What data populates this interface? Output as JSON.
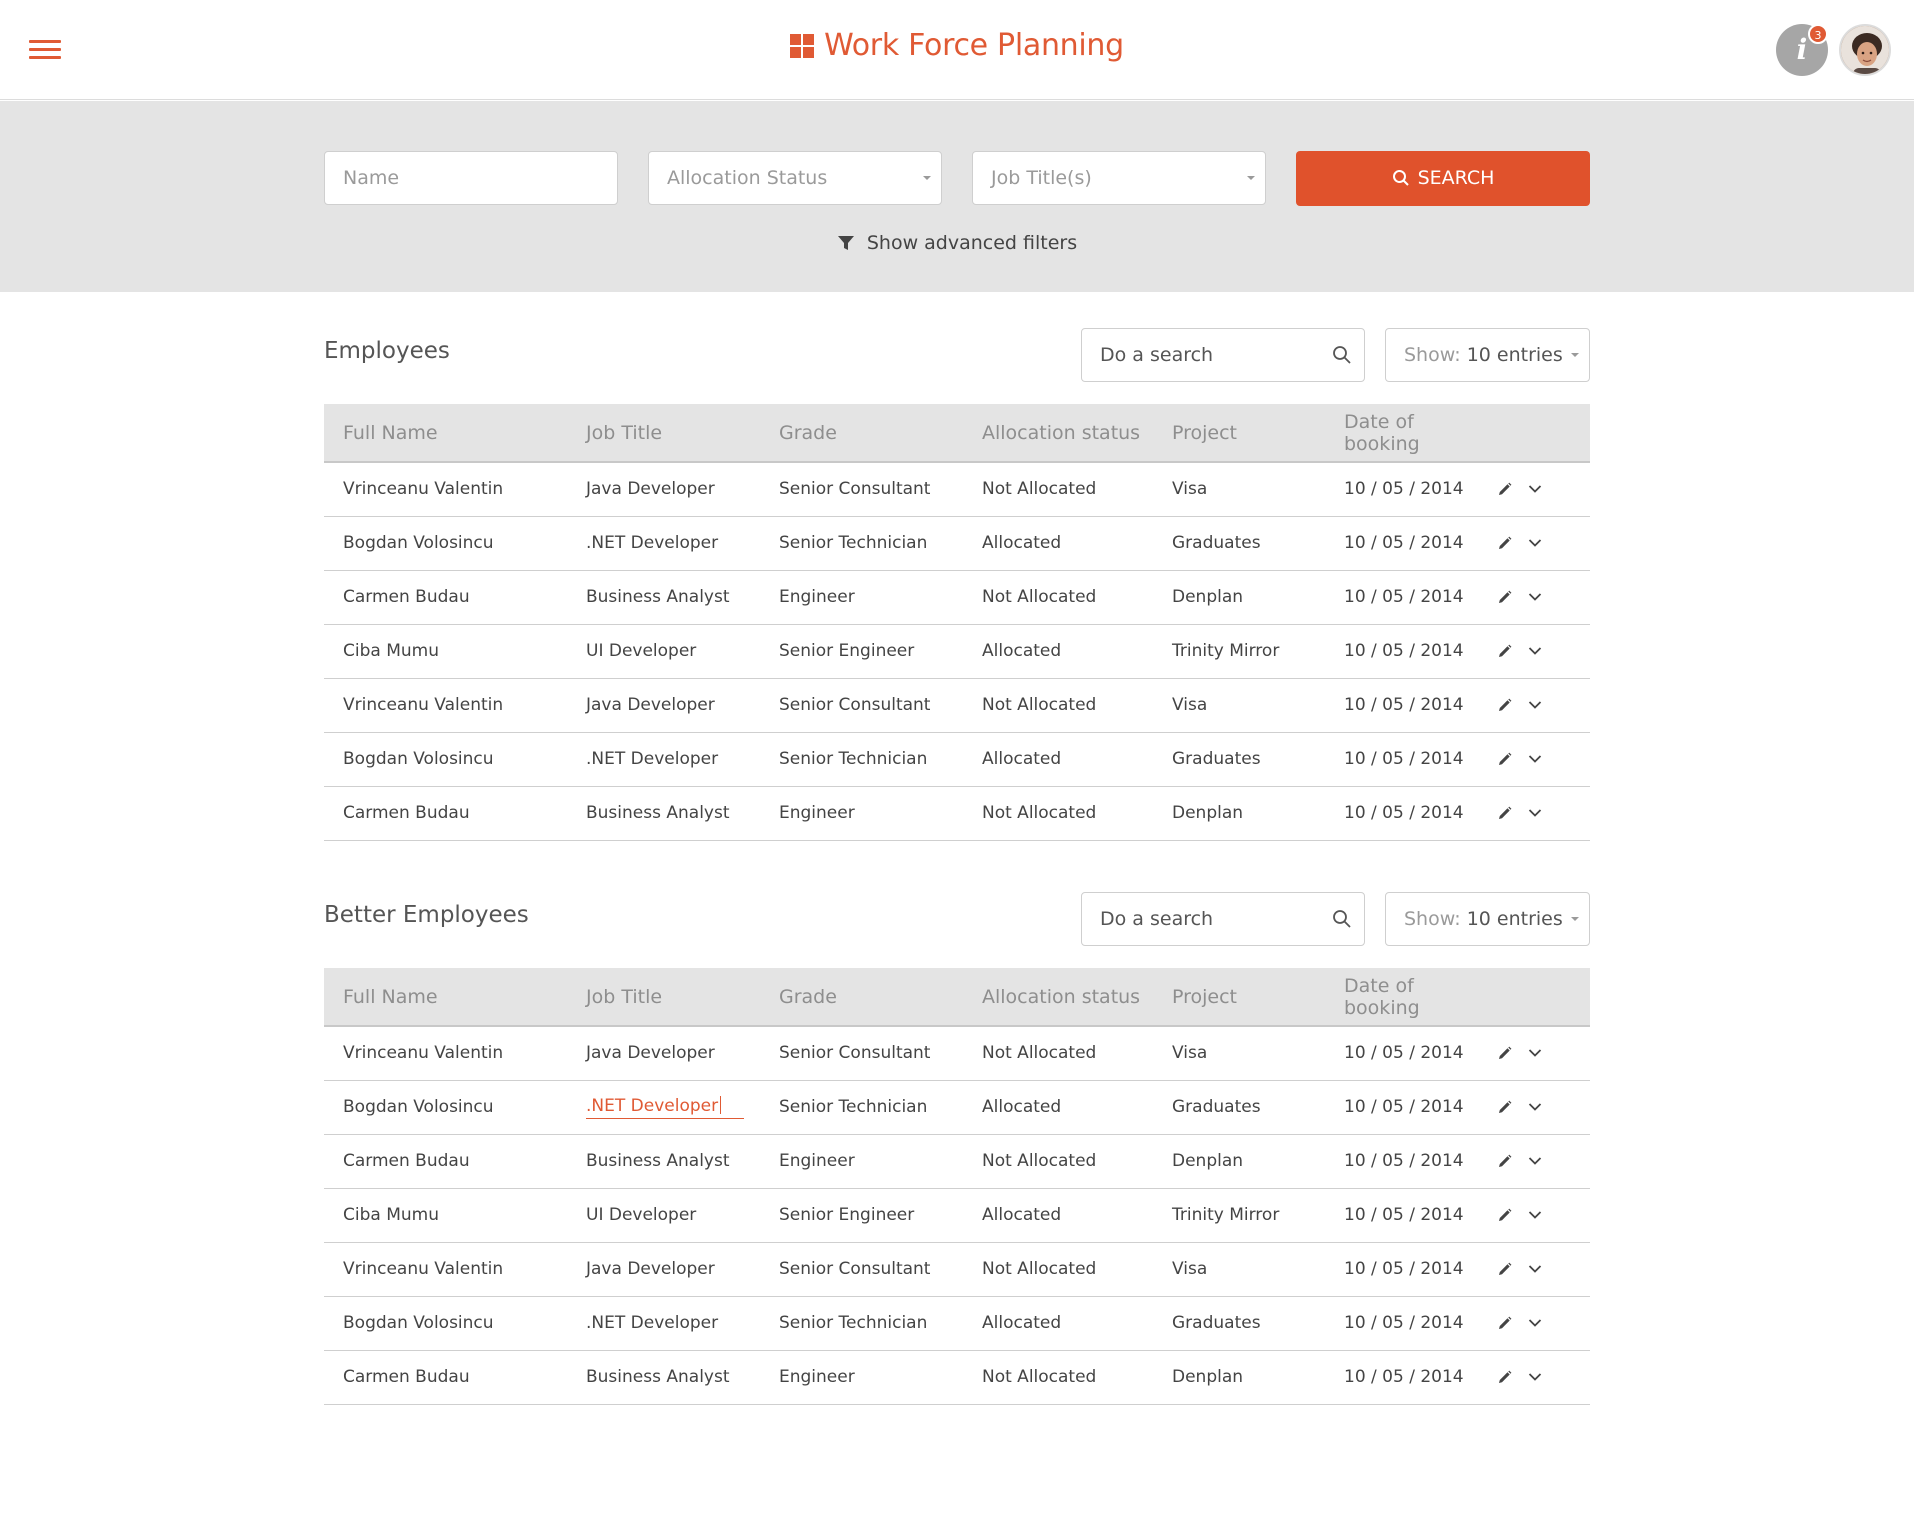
{
  "header": {
    "title": "Work Force Planning",
    "info_label": "i",
    "notification_count": "3",
    "brand_color": "#e05a34"
  },
  "filters": {
    "name_placeholder": "Name",
    "allocation_status_placeholder": "Allocation Status",
    "job_titles_placeholder": "Job Title(s)",
    "search_button": "SEARCH",
    "advanced_filters": "Show advanced filters"
  },
  "employees": {
    "title": "Employees",
    "search_placeholder": "Do a search",
    "show_label": "Show:",
    "show_value": "10 entries",
    "columns": [
      "Full Name",
      "Job Title",
      "Grade",
      "Allocation status",
      "Project",
      "Date of booking"
    ],
    "rows": [
      [
        "Vrinceanu Valentin",
        "Java Developer",
        "Senior Consultant",
        "Not Allocated",
        "Visa",
        "10 / 05 / 2014"
      ],
      [
        "Bogdan Volosincu",
        ".NET Developer",
        "Senior Technician",
        "Allocated",
        "Graduates",
        "10 / 05 / 2014"
      ],
      [
        "Carmen Budau",
        "Business Analyst",
        "Engineer",
        "Not Allocated",
        "Denplan",
        "10 / 05 / 2014"
      ],
      [
        "Ciba Mumu",
        "UI Developer",
        "Senior Engineer",
        "Allocated",
        "Trinity Mirror",
        "10 / 05 / 2014"
      ],
      [
        "Vrinceanu Valentin",
        "Java Developer",
        "Senior Consultant",
        "Not Allocated",
        "Visa",
        "10 / 05 / 2014"
      ],
      [
        "Bogdan Volosincu",
        ".NET Developer",
        "Senior Technician",
        "Allocated",
        "Graduates",
        "10 / 05 / 2014"
      ],
      [
        "Carmen Budau",
        "Business Analyst",
        "Engineer",
        "Not Allocated",
        "Denplan",
        "10 / 05 / 2014"
      ]
    ]
  },
  "better_employees": {
    "title": "Better Employees",
    "search_placeholder": "Do a search",
    "show_label": "Show:",
    "show_value": "10 entries",
    "columns": [
      "Full Name",
      "Job Title",
      "Grade",
      "Allocation status",
      "Project",
      "Date of booking"
    ],
    "editing_cell": {
      "row": 1,
      "col": 1
    },
    "rows": [
      [
        "Vrinceanu Valentin",
        "Java Developer",
        "Senior Consultant",
        "Not Allocated",
        "Visa",
        "10 / 05 / 2014"
      ],
      [
        "Bogdan Volosincu",
        ".NET Developer",
        "Senior Technician",
        "Allocated",
        "Graduates",
        "10 / 05 / 2014"
      ],
      [
        "Carmen Budau",
        "Business Analyst",
        "Engineer",
        "Not Allocated",
        "Denplan",
        "10 / 05 / 2014"
      ],
      [
        "Ciba Mumu",
        "UI Developer",
        "Senior Engineer",
        "Allocated",
        "Trinity Mirror",
        "10 / 05 / 2014"
      ],
      [
        "Vrinceanu Valentin",
        "Java Developer",
        "Senior Consultant",
        "Not Allocated",
        "Visa",
        "10 / 05 / 2014"
      ],
      [
        "Bogdan Volosincu",
        ".NET Developer",
        "Senior Technician",
        "Allocated",
        "Graduates",
        "10 / 05 / 2014"
      ],
      [
        "Carmen Budau",
        "Business Analyst",
        "Engineer",
        "Not Allocated",
        "Denplan",
        "10 / 05 / 2014"
      ]
    ]
  },
  "icons": {
    "menu": "hamburger-menu-icon",
    "logo": "grid-logo-icon",
    "info": "info-icon",
    "search": "search-icon",
    "filter": "filter-icon",
    "edit": "pencil-icon",
    "expand": "chevron-down-icon",
    "dropdown": "caret-down-icon"
  }
}
